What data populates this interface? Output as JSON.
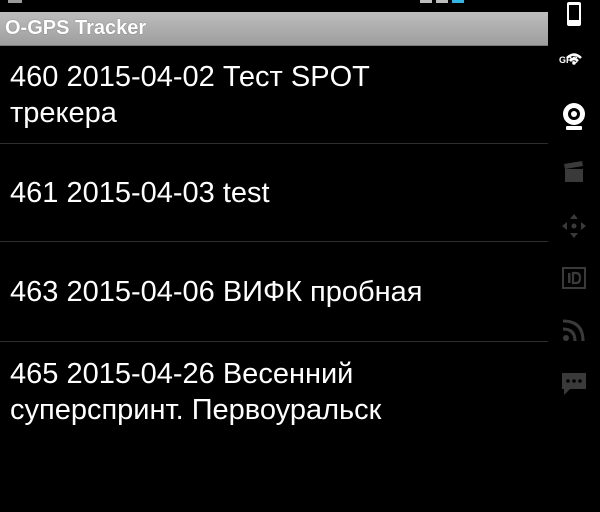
{
  "app": {
    "title": "O-GPS Tracker"
  },
  "list": {
    "items": [
      {
        "text": "460 2015-04-02 Тест SPOT\nтрекера"
      },
      {
        "text": "461 2015-04-03 test"
      },
      {
        "text": "463 2015-04-06 ВИФК пробная"
      },
      {
        "text": "465 2015-04-26 Весенний\nсуперспринт. Первоуральск"
      }
    ]
  },
  "sidebar": {
    "buttons": [
      {
        "icon": "phone-icon"
      },
      {
        "icon": "gps-icon",
        "label": "GPS"
      },
      {
        "icon": "webcam-icon"
      },
      {
        "icon": "clapperboard-icon"
      },
      {
        "icon": "move-arrows-icon"
      },
      {
        "icon": "id-card-icon"
      },
      {
        "icon": "rss-feed-icon"
      },
      {
        "icon": "chat-icon"
      }
    ]
  },
  "colors": {
    "background": "#000000",
    "title_bar": "#b0b0b0",
    "divider": "#2e2e2e",
    "icon_active": "#ffffff",
    "icon_inactive": "#3a3a3a"
  }
}
